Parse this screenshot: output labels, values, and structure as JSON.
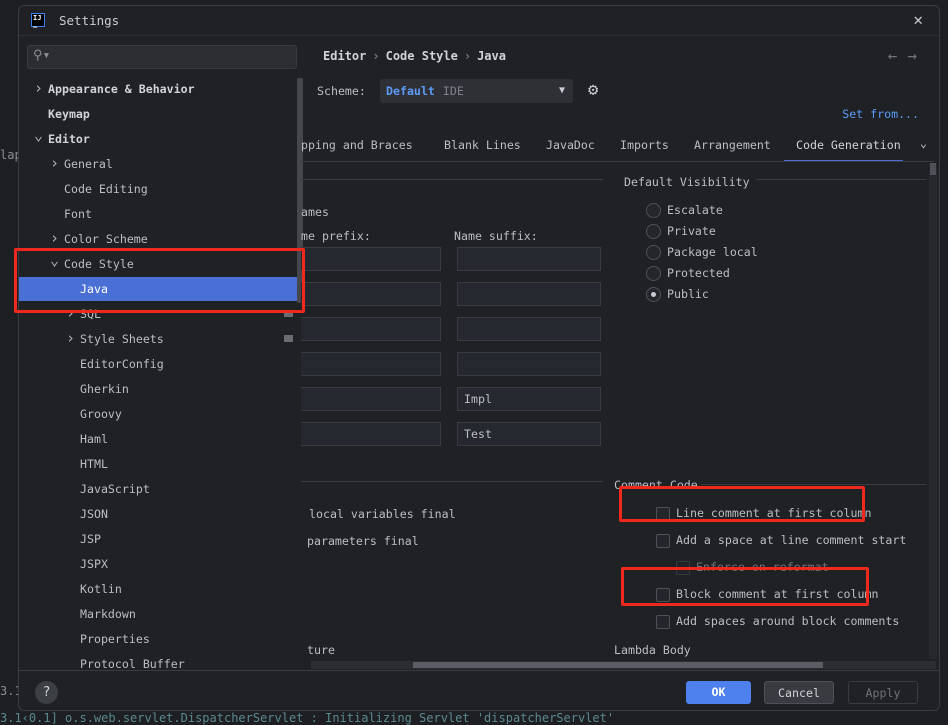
{
  "background": {
    "left_fragment_1": "lapt",
    "left_fragment_2": "3.1",
    "log_line": "3.1‹0.1] o.s.web.servlet.DispatcherServlet        : Initializing Servlet 'dispatcherServlet'"
  },
  "dialog": {
    "logo": "IJ",
    "title": "Settings",
    "close_icon": "close-icon"
  },
  "sidebar": {
    "search_placeholder": "",
    "items": [
      {
        "label": "Appearance & Behavior",
        "level": 0,
        "expandable": true,
        "expanded": false
      },
      {
        "label": "Keymap",
        "level": 0
      },
      {
        "label": "Editor",
        "level": 0,
        "expandable": true,
        "expanded": true
      },
      {
        "label": "General",
        "level": 1,
        "expandable": true
      },
      {
        "label": "Code Editing",
        "level": 1
      },
      {
        "label": "Font",
        "level": 1
      },
      {
        "label": "Color Scheme",
        "level": 1,
        "expandable": true
      },
      {
        "label": "Code Style",
        "level": 1,
        "expandable": true,
        "expanded": true
      },
      {
        "label": "Java",
        "level": 2,
        "selected": true
      },
      {
        "label": "SQL",
        "level": 2,
        "expandable": true
      },
      {
        "label": "Style Sheets",
        "level": 2,
        "expandable": true
      },
      {
        "label": "EditorConfig",
        "level": 2
      },
      {
        "label": "Gherkin",
        "level": 2
      },
      {
        "label": "Groovy",
        "level": 2
      },
      {
        "label": "Haml",
        "level": 2
      },
      {
        "label": "HTML",
        "level": 2
      },
      {
        "label": "JavaScript",
        "level": 2
      },
      {
        "label": "JSON",
        "level": 2
      },
      {
        "label": "JSP",
        "level": 2
      },
      {
        "label": "JSPX",
        "level": 2
      },
      {
        "label": "Kotlin",
        "level": 2
      },
      {
        "label": "Markdown",
        "level": 2
      },
      {
        "label": "Properties",
        "level": 2
      },
      {
        "label": "Protocol Buffer",
        "level": 2
      }
    ]
  },
  "breadcrumb": [
    "Editor",
    "Code Style",
    "Java"
  ],
  "scheme": {
    "label": "Scheme:",
    "name": "Default",
    "type": "IDE"
  },
  "set_from": "Set from...",
  "tabs": [
    {
      "label": "pping and Braces"
    },
    {
      "label": "Blank Lines"
    },
    {
      "label": "JavaDoc"
    },
    {
      "label": "Imports"
    },
    {
      "label": "Arrangement"
    },
    {
      "label": "Code Generation",
      "active": true
    }
  ],
  "naming": {
    "title": "ames",
    "prefix_header": "me prefix:",
    "suffix_header": "Name suffix:",
    "prefix_values": [
      "",
      "",
      "",
      "",
      "",
      ""
    ],
    "suffix_values": [
      "",
      "",
      "",
      "",
      "Impl",
      "Test"
    ]
  },
  "final_modifiers": [
    "local variables final",
    "parameters final"
  ],
  "default_visibility": {
    "title": "Default Visibility",
    "options": [
      "Escalate",
      "Private",
      "Package local",
      "Protected",
      "Public"
    ],
    "selected": "Public"
  },
  "comment_code": {
    "title": "Comment Code",
    "options": [
      {
        "label": "Line comment at first column",
        "checked": false,
        "highlighted": true
      },
      {
        "label": "Add a space at line comment start",
        "checked": false
      },
      {
        "label": "Enforce on reformat",
        "checked": false,
        "disabled": true
      },
      {
        "label": "Block comment at first column",
        "checked": false,
        "highlighted": true
      },
      {
        "label": "Add spaces around block comments",
        "checked": false
      }
    ]
  },
  "bottom_sections": {
    "left": "ture",
    "right": "Lambda Body"
  },
  "footer": {
    "help": "?",
    "ok": "OK",
    "cancel": "Cancel",
    "apply": "Apply"
  },
  "colors": {
    "accent": "#4e80ee",
    "selection": "#4a70d6",
    "highlight_box": "#f0291f",
    "link": "#5c9cf5"
  }
}
